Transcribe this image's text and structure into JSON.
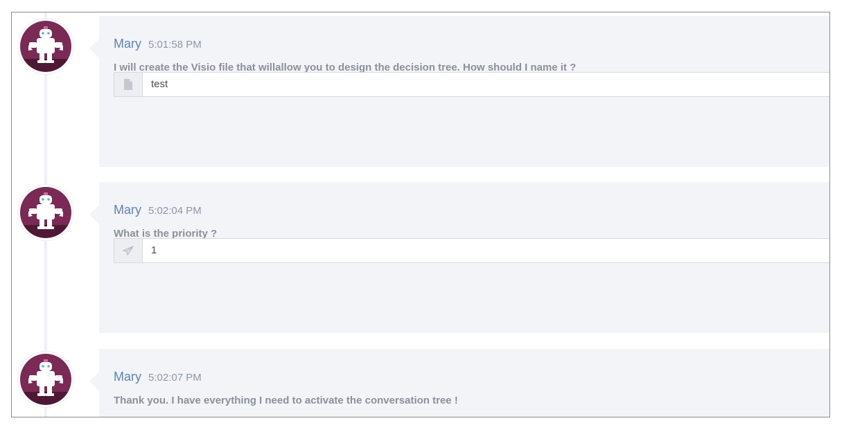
{
  "messages": [
    {
      "sender": "Mary",
      "time": "5:01:58 PM",
      "text": "I will create the Visio file that willallow you to design the decision tree. How should I name it ?",
      "answer": {
        "icon": "file-icon",
        "value": "test"
      }
    },
    {
      "sender": "Mary",
      "time": "5:02:04 PM",
      "text": "What is the priority ?",
      "answer": {
        "icon": "paper-plane-icon",
        "value": "1"
      }
    },
    {
      "sender": "Mary",
      "time": "5:02:07 PM",
      "text": "Thank you. I have everything I need to activate the conversation tree !"
    }
  ],
  "colors": {
    "avatar_bg": "#7a2a55",
    "sender": "#5a83b8",
    "bubble_bg": "#f3f4f8"
  }
}
